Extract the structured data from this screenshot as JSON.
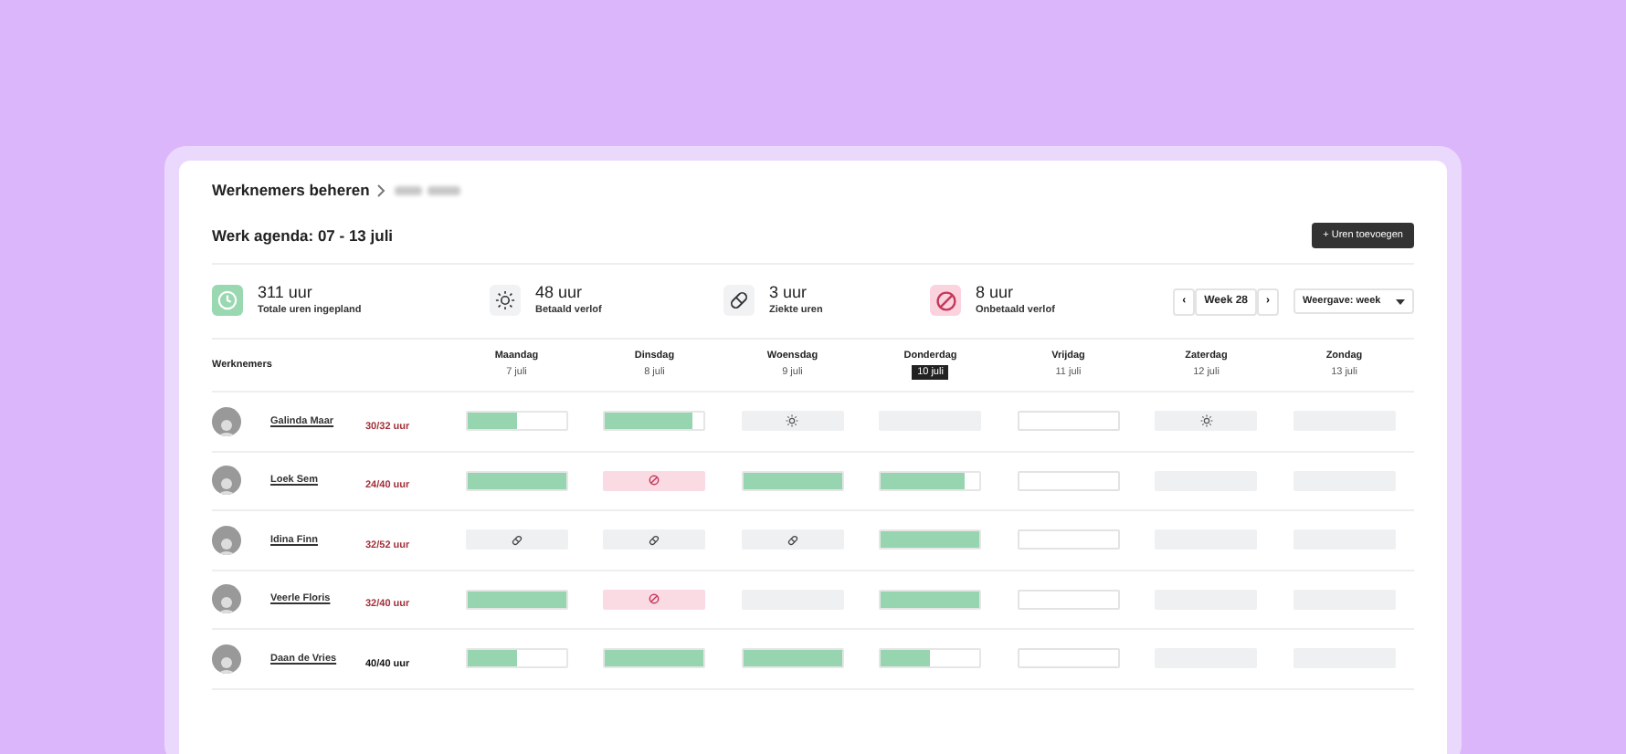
{
  "breadcrumb": {
    "parent": "Werknemers beheren"
  },
  "title": "Werk agenda: 07 - 13 juli",
  "add_button": "+ Uren toevoegen",
  "stats": [
    {
      "kind": "clock",
      "value": "311 uur",
      "label": "Totale uren ingepland"
    },
    {
      "kind": "sun",
      "value": "48 uur",
      "label": "Betaald verlof"
    },
    {
      "kind": "pill",
      "value": "3 uur",
      "label": "Ziekte uren"
    },
    {
      "kind": "ban",
      "value": "8 uur",
      "label": "Onbetaald verlof"
    }
  ],
  "week_nav": {
    "prev": "‹",
    "label": "Week 28",
    "next": "›"
  },
  "view_select": {
    "value": "Weergave: week"
  },
  "table": {
    "first_column": "Werknemers",
    "days": [
      {
        "name": "Maandag",
        "date": "7 juli",
        "selected": false
      },
      {
        "name": "Dinsdag",
        "date": "8 juli",
        "selected": false
      },
      {
        "name": "Woensdag",
        "date": "9 juli",
        "selected": false
      },
      {
        "name": "Donderdag",
        "date": "10 juli",
        "selected": true
      },
      {
        "name": "Vrijdag",
        "date": "11 juli",
        "selected": false
      },
      {
        "name": "Zaterdag",
        "date": "12 juli",
        "selected": false
      },
      {
        "name": "Zondag",
        "date": "13 juli",
        "selected": false
      }
    ],
    "rows": [
      {
        "name": "Galinda Maar",
        "hours": "30/32 uur",
        "complete": false,
        "cells": [
          {
            "kind": "work",
            "level": 0.5
          },
          {
            "kind": "work",
            "level": 0.88
          },
          {
            "kind": "vacation"
          },
          {
            "kind": "off"
          },
          {
            "kind": "empty"
          },
          {
            "kind": "vacation"
          },
          {
            "kind": "off"
          }
        ]
      },
      {
        "name": "Loek Sem",
        "hours": "24/40 uur",
        "complete": false,
        "cells": [
          {
            "kind": "work",
            "level": 1
          },
          {
            "kind": "unpaid"
          },
          {
            "kind": "work",
            "level": 1
          },
          {
            "kind": "work",
            "level": 0.84
          },
          {
            "kind": "empty"
          },
          {
            "kind": "off"
          },
          {
            "kind": "off"
          }
        ]
      },
      {
        "name": "Idina Finn",
        "hours": "32/52 uur",
        "complete": false,
        "cells": [
          {
            "kind": "sick"
          },
          {
            "kind": "sick"
          },
          {
            "kind": "sick"
          },
          {
            "kind": "work",
            "level": 1
          },
          {
            "kind": "empty"
          },
          {
            "kind": "off"
          },
          {
            "kind": "off"
          }
        ]
      },
      {
        "name": "Veerle Floris",
        "hours": "32/40 uur",
        "complete": false,
        "cells": [
          {
            "kind": "work",
            "level": 1
          },
          {
            "kind": "unpaid"
          },
          {
            "kind": "off"
          },
          {
            "kind": "work",
            "level": 1
          },
          {
            "kind": "empty"
          },
          {
            "kind": "off"
          },
          {
            "kind": "off"
          }
        ]
      },
      {
        "name": "Daan de Vries",
        "hours": "40/40 uur",
        "complete": true,
        "cells": [
          {
            "kind": "work",
            "level": 0.5
          },
          {
            "kind": "work",
            "level": 1
          },
          {
            "kind": "work",
            "level": 1
          },
          {
            "kind": "work",
            "level": 0.5
          },
          {
            "kind": "empty"
          },
          {
            "kind": "off"
          },
          {
            "kind": "off"
          }
        ]
      }
    ]
  }
}
